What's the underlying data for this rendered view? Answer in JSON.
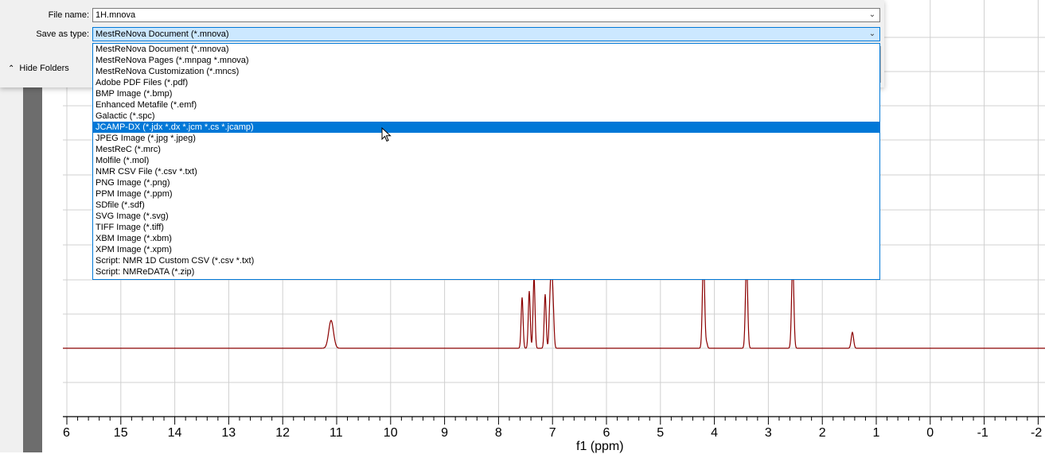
{
  "dialog": {
    "file_name_label": "File name:",
    "file_name_value": "1H.mnova",
    "save_type_label": "Save as type:",
    "save_type_value": "MestReNova Document (*.mnova)",
    "hide_folders_label": "Hide Folders",
    "file_types": [
      "MestReNova Document (*.mnova)",
      "MestReNova Pages (*.mnpag *.mnova)",
      "MestReNova Customization (*.mncs)",
      "Adobe PDF Files (*.pdf)",
      "BMP Image (*.bmp)",
      "Enhanced Metafile (*.emf)",
      "Galactic (*.spc)",
      "JCAMP-DX (*.jdx *.dx *.jcm *.cs *.jcamp)",
      "JPEG Image (*.jpg *.jpeg)",
      "MestReC (*.mrc)",
      "Molfile (*.mol)",
      "NMR CSV File (*.csv *.txt)",
      "PNG Image (*.png)",
      "PPM Image (*.ppm)",
      "SDfile (*.sdf)",
      "SVG Image (*.svg)",
      "TIFF Image (*.tiff)",
      "XBM Image (*.xbm)",
      "XPM Image (*.xpm)",
      "Script: NMR 1D Custom CSV (*.csv *.txt)",
      "Script: NMReDATA (*.zip)"
    ],
    "highlighted_index": 7
  },
  "spectrum": {
    "axis_title": "f1 (ppm)",
    "tick_labels": [
      "6",
      "15",
      "14",
      "13",
      "12",
      "11",
      "10",
      "9",
      "8",
      "7",
      "6",
      "5",
      "4",
      "3",
      "2",
      "1",
      "0",
      "-1",
      "-2"
    ],
    "line_color": "#8b0000"
  }
}
